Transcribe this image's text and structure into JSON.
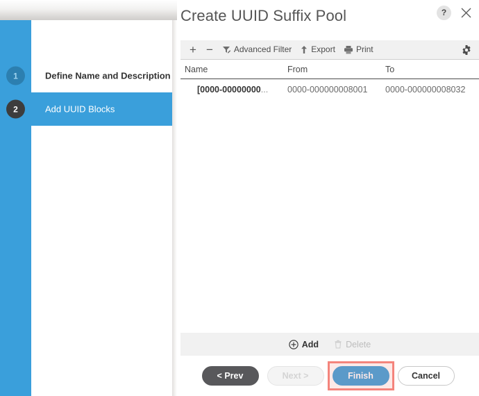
{
  "dialog": {
    "title": "Create UUID Suffix Pool",
    "help_label": "?",
    "close_label": "✕"
  },
  "wizard": {
    "steps": [
      {
        "number": "1",
        "label": "Define Name and Description",
        "state": "done"
      },
      {
        "number": "2",
        "label": "Add UUID Blocks",
        "state": "active"
      }
    ]
  },
  "toolbar": {
    "add_label": "+",
    "remove_label": "−",
    "advanced_filter_label": "Advanced Filter",
    "export_label": "Export",
    "print_label": "Print",
    "settings_label": ""
  },
  "table": {
    "columns": [
      "Name",
      "From",
      "To"
    ],
    "rows": [
      {
        "name": "[0000-00000000",
        "name_ellipsis": "...",
        "from": "0000-000000008001",
        "to": "0000-000000008032"
      }
    ]
  },
  "actions": {
    "add_label": "Add",
    "delete_label": "Delete"
  },
  "footer": {
    "prev_label": "< Prev",
    "next_label": "Next >",
    "finish_label": "Finish",
    "cancel_label": "Cancel"
  },
  "colors": {
    "accent_blue": "#3a9fdb",
    "step_badge_done": "#2c7fb0",
    "step_badge_active": "#3d3d3d",
    "prev_button": "#58585b",
    "highlight": "#f4847c"
  }
}
